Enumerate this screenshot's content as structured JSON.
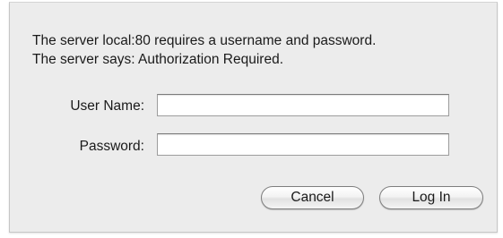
{
  "dialog": {
    "message_line1": "The server local:80 requires a username and password.",
    "message_line2": "The server says: Authorization Required."
  },
  "form": {
    "username_label": "User Name:",
    "username_value": "",
    "password_label": "Password:",
    "password_value": ""
  },
  "buttons": {
    "cancel_label": "Cancel",
    "login_label": "Log In"
  }
}
